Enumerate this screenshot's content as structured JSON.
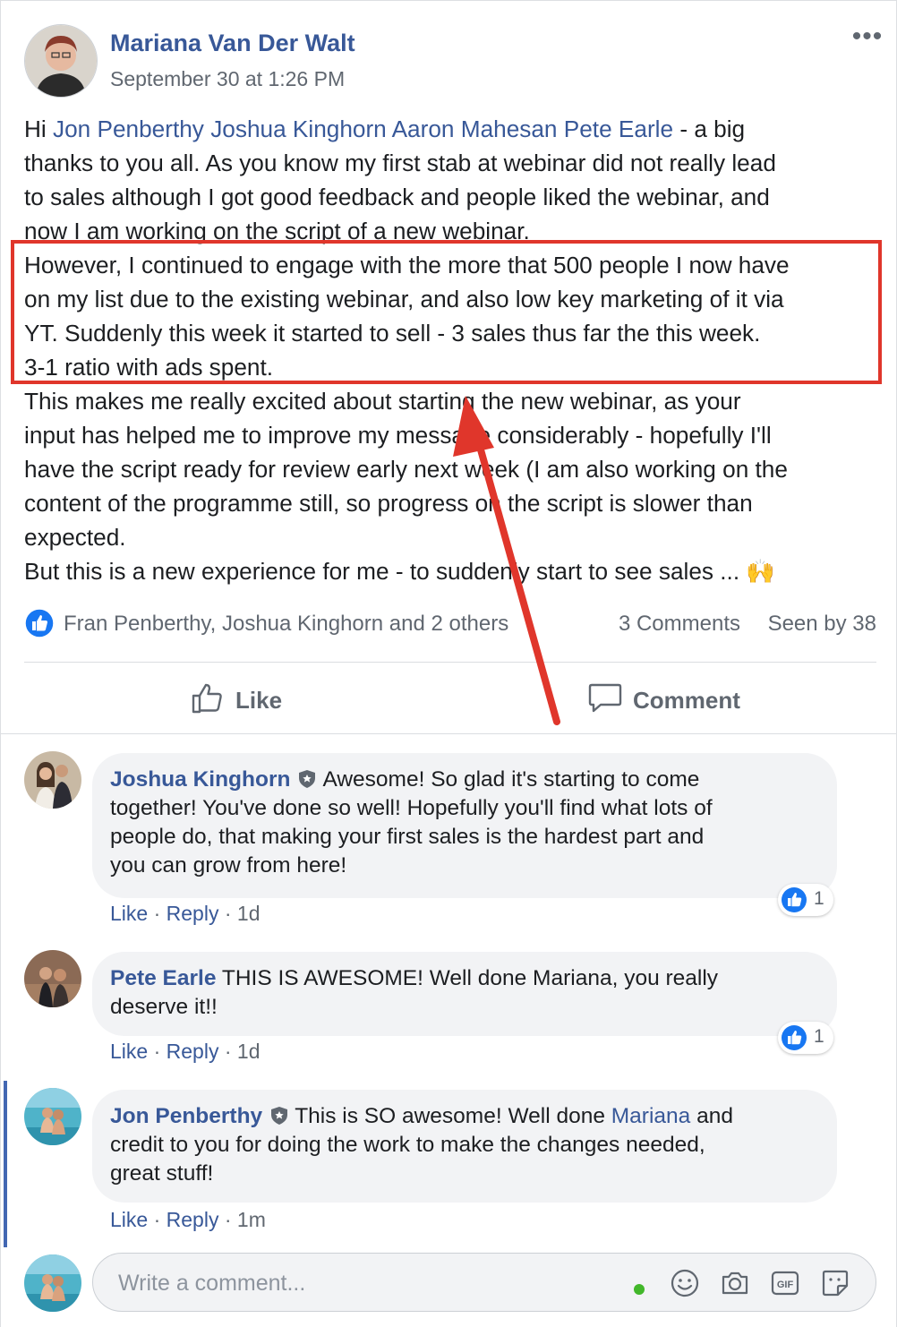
{
  "post": {
    "author": "Mariana Van Der Walt",
    "timestamp": "September 30 at 1:26 PM",
    "more_label": "•••",
    "body": {
      "greeting": "Hi ",
      "mentions": [
        "Jon Penberthy",
        "Joshua Kinghorn",
        "Aaron Mahesan",
        "Pete Earle"
      ],
      "line1_rest": " - a big",
      "line2": "thanks to you all. As you know my first stab at webinar did not really lead",
      "line3": "to sales although I got good feedback and people liked the webinar, and",
      "line4": "now I am working on the script of a new webinar.",
      "line5": "However, I continued to engage with the more that 500 people I now have",
      "line6": "on my list due to the existing webinar, and also low key marketing of it via",
      "line7": "YT. Suddenly this week it started to sell - 3 sales thus far the this week.",
      "line8": "3-1 ratio with ads spent.",
      "line9": "This makes me really excited about starting the new webinar, as your",
      "line10": "input has helped me to improve my message considerably - hopefully I'll",
      "line11": "have the script ready for review early next week (I am also working on the",
      "line12": "content of the programme still, so progress on the script is slower than",
      "line13": "expected.",
      "line14": "But this is a new experience for me - to suddenly start to see sales ... 🙌"
    },
    "reactors": "Fran Penberthy, Joshua Kinghorn and 2 others",
    "comments_count": "3 Comments",
    "seen_by": "Seen by 38",
    "like_label": "Like",
    "comment_label": "Comment"
  },
  "comments": [
    {
      "name": "Joshua Kinghorn",
      "lines": [
        "Awesome! So glad it's starting to come",
        "together! You've done so well! Hopefully you'll find what lots of",
        "people do, that making your first sales is the hardest part and",
        "you can grow from here!"
      ],
      "like": "Like",
      "reply": "Reply",
      "age": "1d",
      "reactions": "1"
    },
    {
      "name": "Pete Earle",
      "lines": [
        "THIS IS AWESOME! Well done Mariana, you really",
        "deserve it!!"
      ],
      "like": "Like",
      "reply": "Reply",
      "age": "1d",
      "reactions": "1"
    },
    {
      "name": "Jon Penberthy",
      "line1_pre": "This is SO awesome! Well done ",
      "line1_mention": "Mariana",
      "line1_post": " and",
      "lines": [
        "credit to you for doing the work to make the changes needed,",
        "great stuff!"
      ],
      "like": "Like",
      "reply": "Reply",
      "age": "1m"
    }
  ],
  "composer": {
    "placeholder": "Write a comment..."
  },
  "colors": {
    "link": "#385898",
    "highlight": "#e0362b",
    "like_blue": "#1877f2",
    "online": "#42b72a"
  }
}
